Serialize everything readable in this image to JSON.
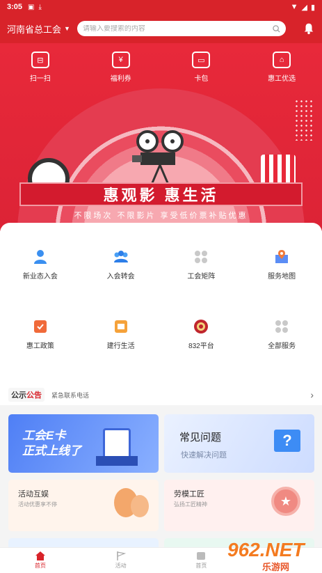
{
  "status_bar": {
    "time": "3:05"
  },
  "header": {
    "region": "河南省总工会",
    "search_placeholder": "请输入要搜索的内容"
  },
  "quick_actions": [
    {
      "label": "扫一扫",
      "icon": "scan-icon"
    },
    {
      "label": "福利券",
      "icon": "coupon-icon"
    },
    {
      "label": "卡包",
      "icon": "wallet-icon"
    },
    {
      "label": "惠工优选",
      "icon": "shop-icon"
    }
  ],
  "banner": {
    "title": "惠观影 惠生活",
    "subtitle": "不限场次 不限影片 享受低价票补贴优惠"
  },
  "services": [
    {
      "label": "新业态入会",
      "icon": "worker-icon"
    },
    {
      "label": "入会转会",
      "icon": "group-icon"
    },
    {
      "label": "工会矩阵",
      "icon": "grid-icon"
    },
    {
      "label": "服务地图",
      "icon": "map-icon"
    },
    {
      "label": "惠工政策",
      "icon": "policy-icon"
    },
    {
      "label": "建行生活",
      "icon": "ccb-life-icon"
    },
    {
      "label": "832平台",
      "icon": "union-emblem-icon"
    },
    {
      "label": "全部服务",
      "icon": "all-services-icon"
    }
  ],
  "notice": {
    "tag_a": "公示",
    "tag_b": "公告",
    "text": "紧急联系电话"
  },
  "tiles": {
    "ecard": {
      "line1": "工会E卡",
      "line2": "正式上线了"
    },
    "faq": {
      "title": "常见问题",
      "sub": "快速解决问题"
    },
    "activity": {
      "title": "活动互娱",
      "sub": "活动优惠享不停"
    },
    "model_worker": {
      "title": "劳模工匠",
      "sub": "弘扬工匠精神"
    }
  },
  "tabbar": [
    {
      "label": "首页",
      "active": true
    },
    {
      "label": "活动",
      "active": false
    },
    {
      "label": "首页",
      "active": false
    }
  ],
  "watermark": {
    "num": "962.NET",
    "sub": "乐游网"
  },
  "colors": {
    "brand_red": "#d8232a"
  }
}
